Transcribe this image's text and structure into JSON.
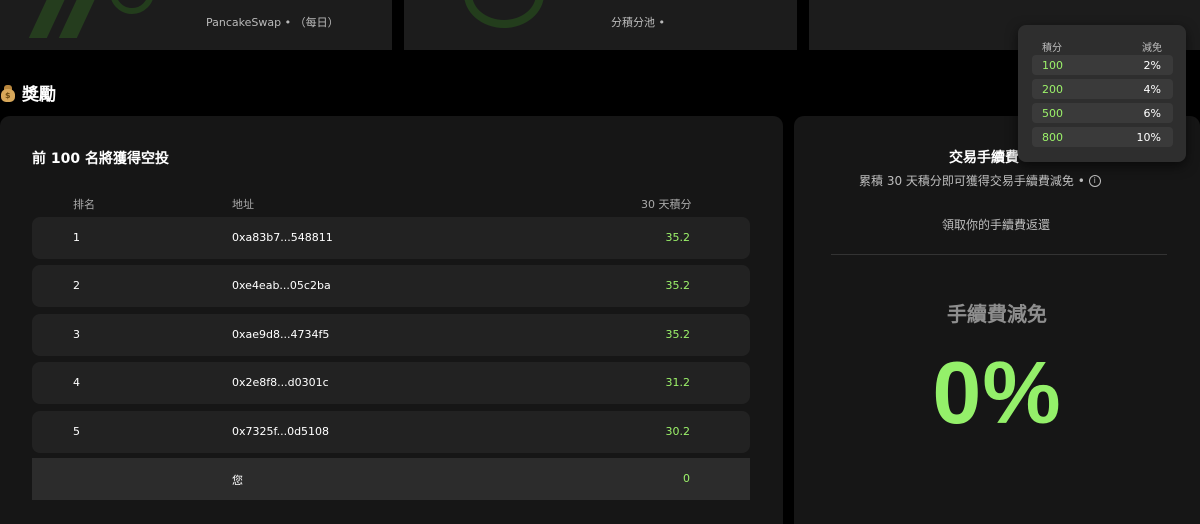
{
  "top_cards": [
    {
      "subtitle": "PancakeSwap • （每日）"
    },
    {
      "subtitle": "分積分池 •"
    },
    {
      "subtitle": ""
    }
  ],
  "rewards": {
    "icon": "money-bag-icon",
    "title": "獎勵"
  },
  "leaderboard": {
    "title": "前 100 名將獲得空投",
    "headers": {
      "rank": "排名",
      "address": "地址",
      "points": "30 天積分"
    },
    "rows": [
      {
        "rank": "1",
        "address": "0xa83b7...548811",
        "points": "35.2"
      },
      {
        "rank": "2",
        "address": "0xe4eab...05c2ba",
        "points": "35.2"
      },
      {
        "rank": "3",
        "address": "0xae9d8...4734f5",
        "points": "35.2"
      },
      {
        "rank": "4",
        "address": "0x2e8f8...d0301c",
        "points": "31.2"
      },
      {
        "rank": "5",
        "address": "0x7325f...0d5108",
        "points": "30.2"
      }
    ],
    "me": {
      "rank": "",
      "address": "您",
      "points": "0"
    }
  },
  "fee_panel": {
    "title": "交易手續費",
    "description": "累積 30 天積分即可獲得交易手續費減免 •",
    "claim_link": "領取你的手續費返還",
    "discount_label": "手續費減免",
    "discount_value": "0%"
  },
  "tooltip": {
    "headers": {
      "points": "積分",
      "rebate": "減免"
    },
    "rows": [
      {
        "points": "100",
        "rebate": "2%"
      },
      {
        "points": "200",
        "rebate": "4%"
      },
      {
        "points": "500",
        "rebate": "6%"
      },
      {
        "points": "800",
        "rebate": "10%"
      }
    ]
  },
  "colors": {
    "accent_green": "#94f06a",
    "panel_bg": "#161616",
    "row_bg": "#222222"
  }
}
